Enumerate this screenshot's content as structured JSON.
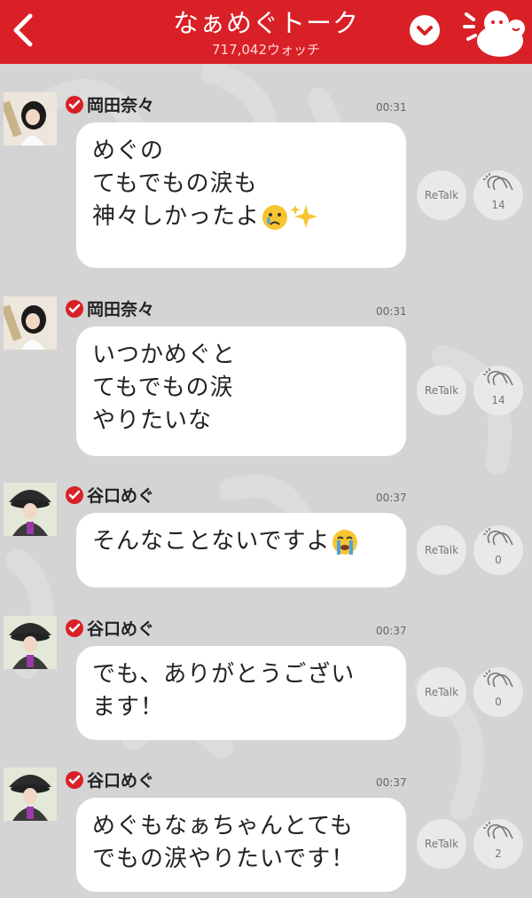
{
  "header": {
    "title": "なぁめぐトーク",
    "watch_count": "717,042ウォッチ",
    "back_icon": "chevron-left-icon",
    "dropdown_icon": "chevron-down-icon",
    "mascot_icon": "mascot-icon",
    "color": "#d92027"
  },
  "messages": [
    {
      "name": "岡田奈々",
      "time": "00:31",
      "text": "めぐの\nてもでもの涙も\n神々しかったよ",
      "emojis": [
        "crying-face",
        "sparkles"
      ],
      "retalk": "ReTalk",
      "claps": "14"
    },
    {
      "name": "岡田奈々",
      "time": "00:31",
      "text": "いつかめぐと\nてもでもの涙\nやりたいな",
      "emojis": [],
      "retalk": "ReTalk",
      "claps": "14"
    },
    {
      "name": "谷口めぐ",
      "time": "00:37",
      "text": "そんなことないですよ",
      "emojis": [
        "loudly-crying-face"
      ],
      "retalk": "ReTalk",
      "claps": "0"
    },
    {
      "name": "谷口めぐ",
      "time": "00:37",
      "text": "でも、ありがとうござい\nます！",
      "emojis": [],
      "retalk": "ReTalk",
      "claps": "0"
    },
    {
      "name": "谷口めぐ",
      "time": "00:37",
      "text": "めぐもなぁちゃんとても\nでもの涙やりたいです！",
      "emojis": [],
      "retalk": "ReTalk",
      "claps": "2"
    }
  ]
}
